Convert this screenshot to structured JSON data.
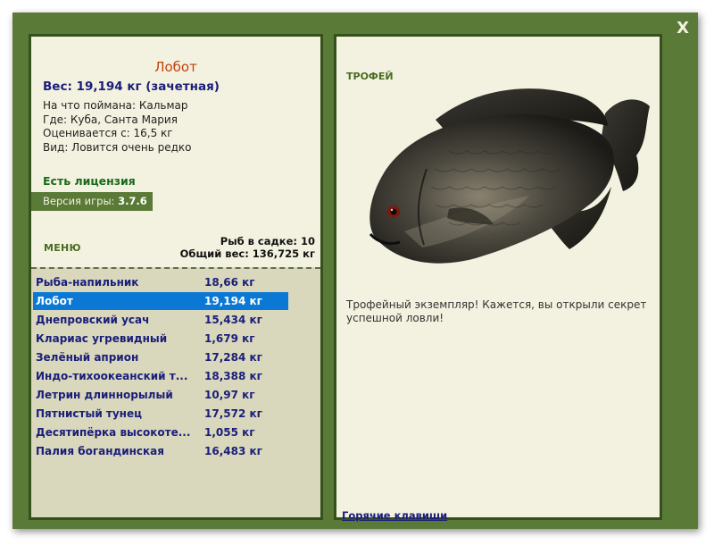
{
  "window": {
    "close_label": "X"
  },
  "fish": {
    "name": "Лобот",
    "weight_line": "Вес: 19,194 кг (зачетная)",
    "bait_line": "На что поймана: Кальмар",
    "where_line": "Где: Куба, Санта Мария",
    "value_line": "Оценивается с: 16,5 кг",
    "kind_line": "Вид: Ловится очень редко"
  },
  "license": "Есть лицензия",
  "version": {
    "label": "Версия игры: ",
    "value": "3.7.6"
  },
  "menu_label": "МЕНЮ",
  "cage": {
    "count_line": "Рыб в садке: 10",
    "total_line": "Общий вес: 136,725 кг"
  },
  "catch_list": [
    {
      "name": "Рыба-напильник",
      "weight": "18,66 кг"
    },
    {
      "name": "Лобот",
      "weight": "19,194 кг",
      "selected": true
    },
    {
      "name": "Днепровский усач",
      "weight": "15,434 кг"
    },
    {
      "name": "Клариас угревидный",
      "weight": "1,679 кг"
    },
    {
      "name": "Зелёный априон",
      "weight": "17,284 кг"
    },
    {
      "name": "Индо-тихоокеанский т...",
      "weight": "18,388 кг"
    },
    {
      "name": "Летрин длиннорылый",
      "weight": "10,97 кг"
    },
    {
      "name": "Пятнистый тунец",
      "weight": "17,572 кг"
    },
    {
      "name": "Десятипёрка высокоте...",
      "weight": "1,055 кг"
    },
    {
      "name": "Палия богандинская",
      "weight": "16,483 кг"
    }
  ],
  "trophy": {
    "title": "ТРОФЕЙ",
    "description": "Трофейный экземпляр! Кажется, вы открыли секрет успешной ловли!"
  },
  "hotkeys_label": "Горячие клавиши",
  "colors": {
    "frame": "#5a7a37",
    "panel": "#f3f2e0",
    "selected": "#0a78d4",
    "name": "#c0420e"
  }
}
